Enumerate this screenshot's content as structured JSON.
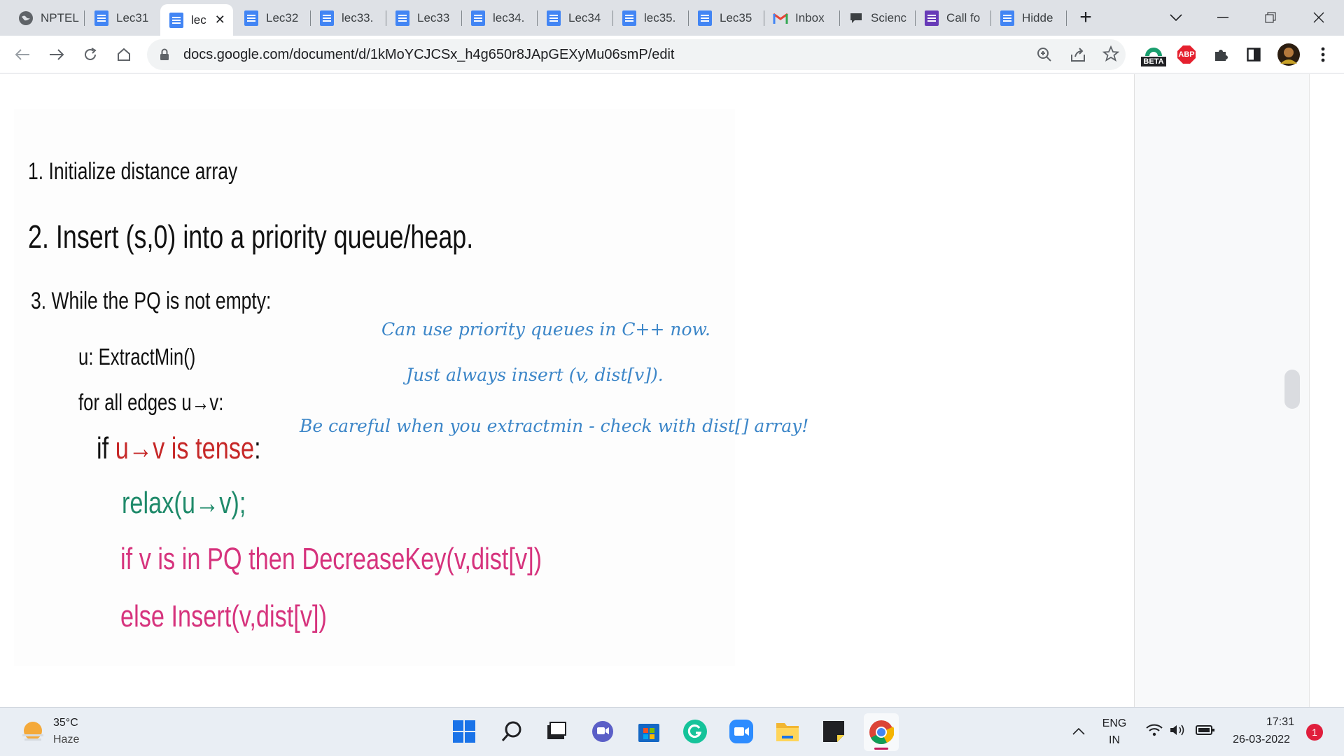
{
  "browser": {
    "tabs": [
      {
        "title": "NPTEL",
        "icon": "globe-icon"
      },
      {
        "title": "Lec31",
        "icon": "docs-icon"
      },
      {
        "title": "lec",
        "icon": "docs-icon",
        "active": true
      },
      {
        "title": "Lec32",
        "icon": "docs-icon"
      },
      {
        "title": "lec33.",
        "icon": "docs-icon"
      },
      {
        "title": "Lec33",
        "icon": "docs-icon"
      },
      {
        "title": "lec34.",
        "icon": "docs-icon"
      },
      {
        "title": "Lec34",
        "icon": "docs-icon"
      },
      {
        "title": "lec35.",
        "icon": "docs-icon"
      },
      {
        "title": "Lec35",
        "icon": "docs-icon"
      },
      {
        "title": "Inbox",
        "icon": "gmail-icon"
      },
      {
        "title": "Scienc",
        "icon": "chat-icon"
      },
      {
        "title": "Call fo",
        "icon": "forms-icon"
      },
      {
        "title": "Hidde",
        "icon": "docs-icon"
      }
    ],
    "new_tab_symbol": "+",
    "url": "docs.google.com/document/d/1kMoYCJCSx_h4g650r8JApGEXyMu06smP/edit",
    "extension_badge": "BETA",
    "abp_label": "ABP"
  },
  "document": {
    "steps": {
      "s1": "1. Initialize distance array",
      "s2": "2. Insert (s,0) into a priority queue/heap.",
      "s3": "3. While the PQ is not empty:",
      "extract": "u: ExtractMin()",
      "forall": "for all edges u→v:",
      "if_prefix": "if ",
      "if_cond": "u→v is tense",
      "if_colon": ":",
      "relax": "relax(u→v);",
      "decrease": "if v is in PQ then DecreaseKey(v,dist[v])",
      "else_insert": "else Insert(v,dist[v])"
    },
    "notes": {
      "n1": "Can use priority queues in C++ now.",
      "n2": "Just always insert (v, dist[v]).",
      "n3": "Be careful when you extractmin - check with dist[] array!"
    },
    "colors": {
      "tense": "#c62828",
      "relax": "#1f8a6a",
      "pink": "#d6337d",
      "note": "#3c86c8"
    }
  },
  "taskbar": {
    "weather_temp": "35°C",
    "weather_desc": "Haze",
    "lang_top": "ENG",
    "lang_bottom": "IN",
    "time": "17:31",
    "date": "26-03-2022",
    "notification_count": "1"
  }
}
